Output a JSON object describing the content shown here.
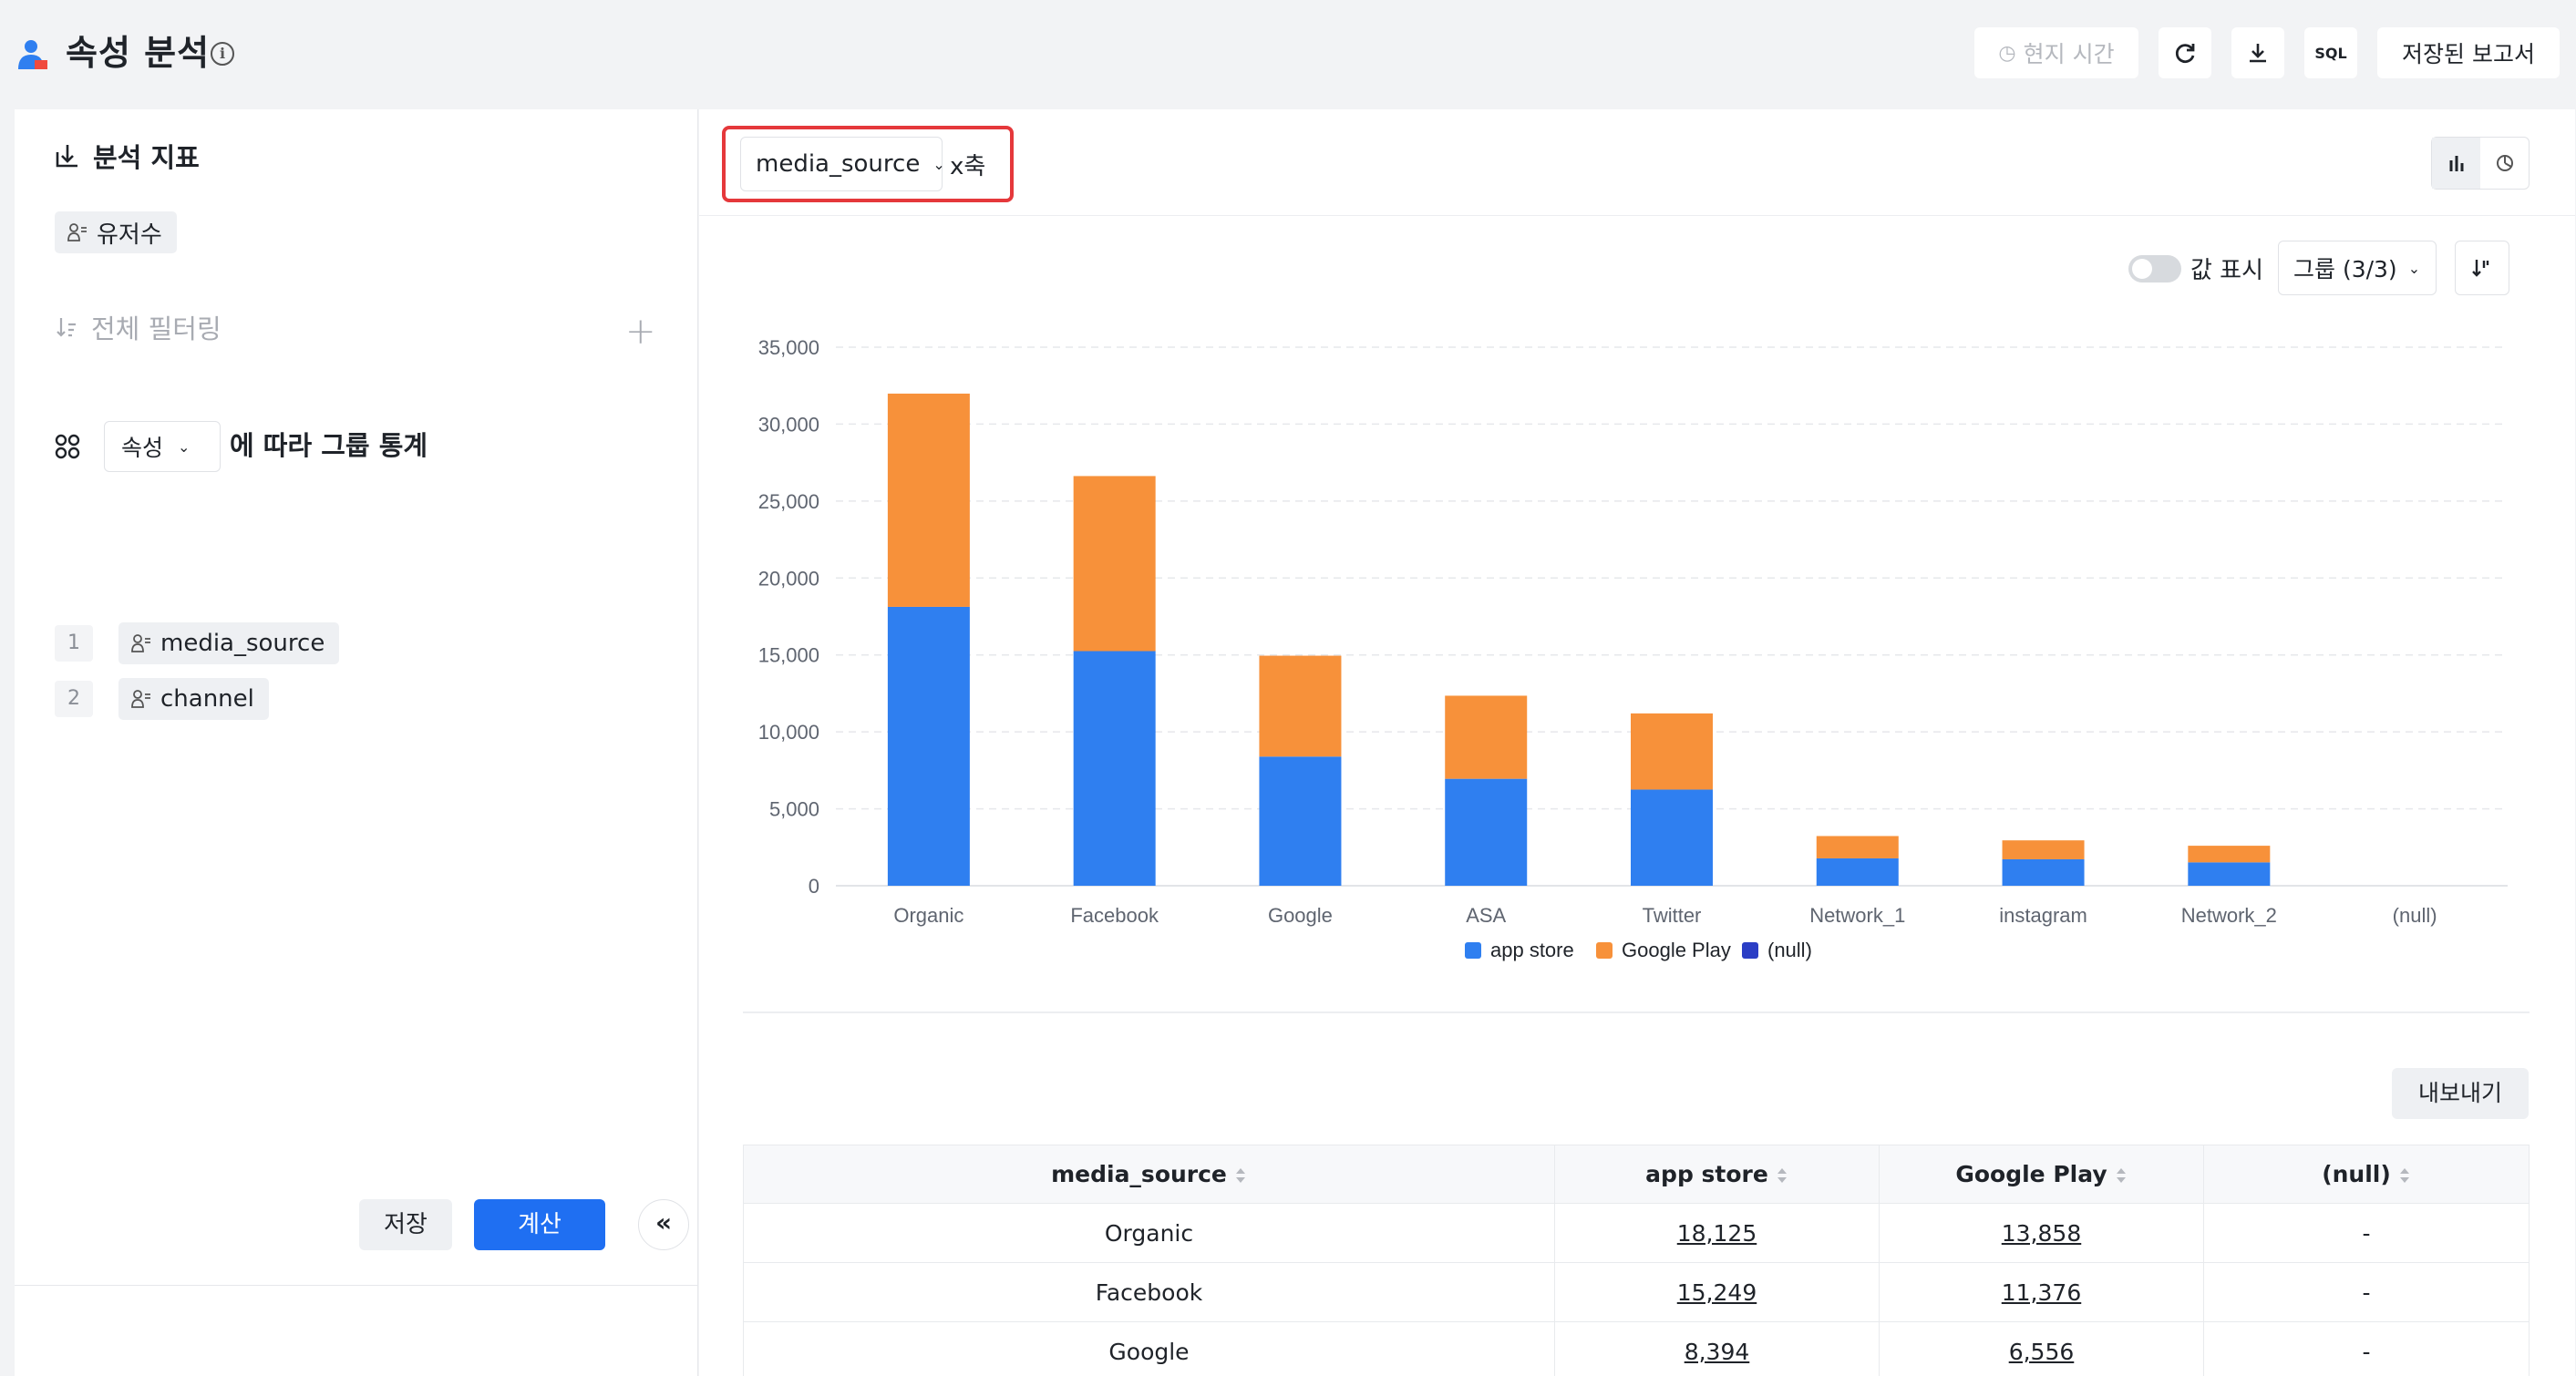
{
  "header": {
    "title": "속성 분석",
    "local_time_label": "현지 시간",
    "sql_label": "SQL",
    "saved_reports_label": "저장된 보고서"
  },
  "left_panel": {
    "metrics_title": "분석 지표",
    "metric_chip": "유저수",
    "filter_title": "전체 필터링",
    "group_select": "속성",
    "group_text": "에 따라 그룹 통계",
    "group_items": [
      {
        "index": "1",
        "label": "media_source"
      },
      {
        "index": "2",
        "label": "channel"
      }
    ],
    "save_label": "저장",
    "calc_label": "계산",
    "collapse_label": "«"
  },
  "toolbar": {
    "x_select": "media_source",
    "x_label": "x축",
    "value_show_label": "값 표시",
    "group_select": "그룹 (3/3)"
  },
  "chart_data": {
    "type": "bar",
    "stacked": true,
    "categories": [
      "Organic",
      "Facebook",
      "Google",
      "ASA",
      "Twitter",
      "Network_1",
      "instagram",
      "Network_2",
      "(null)"
    ],
    "series": [
      {
        "name": "app store",
        "color": "#2f7ff0",
        "values": [
          18125,
          15249,
          8394,
          6950,
          6250,
          1780,
          1720,
          1520,
          0
        ]
      },
      {
        "name": "Google Play",
        "color": "#f7913a",
        "values": [
          13858,
          11376,
          6556,
          5400,
          4950,
          1450,
          1230,
          1080,
          0
        ]
      },
      {
        "name": "(null)",
        "color": "#2b3ec5",
        "values": [
          0,
          0,
          0,
          0,
          0,
          0,
          0,
          0,
          0
        ]
      }
    ],
    "y_ticks": [
      "0",
      "5,000",
      "10,000",
      "15,000",
      "20,000",
      "25,000",
      "30,000",
      "35,000"
    ],
    "ylim": [
      0,
      35000
    ],
    "grid": true,
    "legend_position": "bottom"
  },
  "table": {
    "export_label": "내보내기",
    "headers": [
      "media_source",
      "app store",
      "Google Play",
      "(null)"
    ],
    "rows": [
      [
        "Organic",
        "18,125",
        "13,858",
        "-"
      ],
      [
        "Facebook",
        "15,249",
        "11,376",
        "-"
      ],
      [
        "Google",
        "8,394",
        "6,556",
        "-"
      ]
    ]
  }
}
